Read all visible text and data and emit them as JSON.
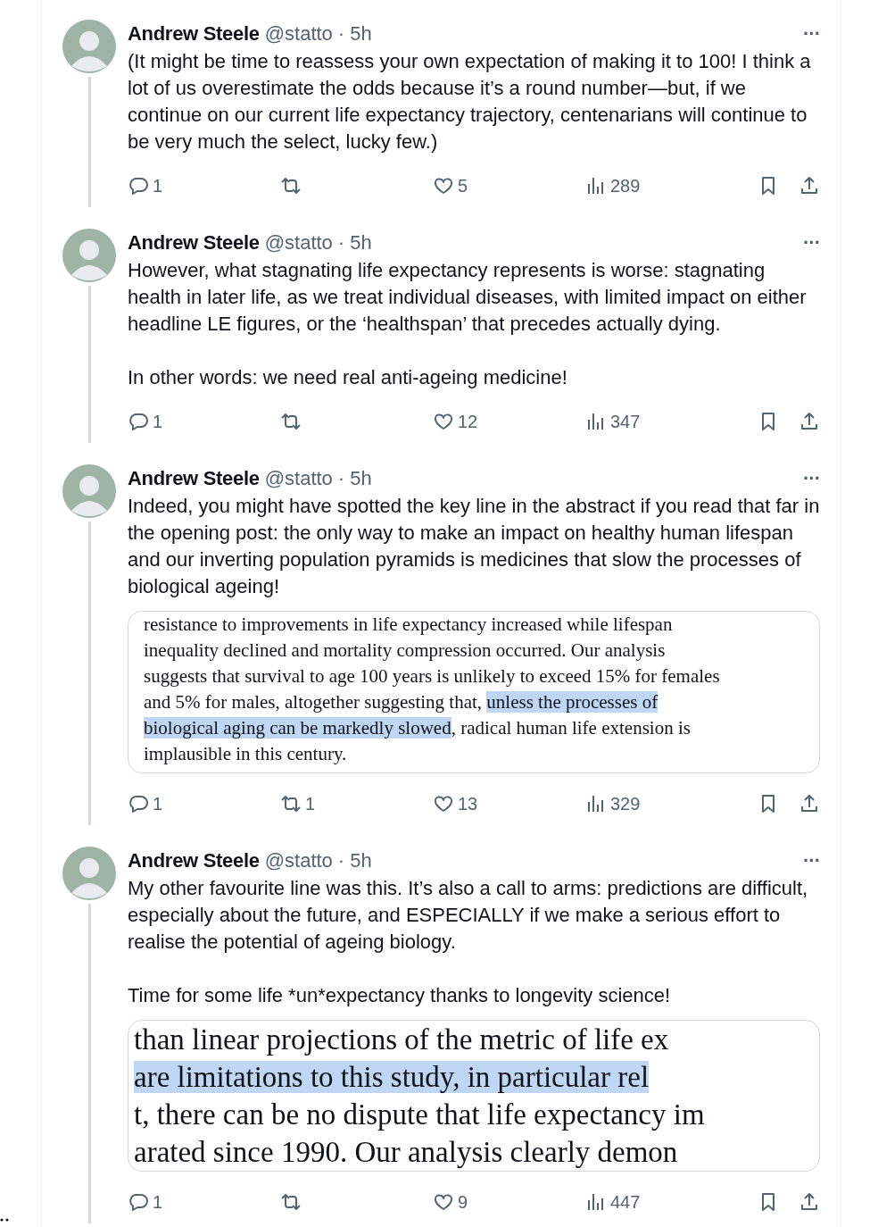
{
  "tweets": [
    {
      "name": "Andrew Steele",
      "handle": "@statto",
      "separator": "·",
      "time": "5h",
      "more": "···",
      "paragraphs": [
        "(It might be time to reassess your own expectation of making it to 100! I think a lot of us overestimate the odds because it’s a round number—but, if we continue on our current life expectancy trajectory, centenarians will continue to be very much the select, lucky few.)"
      ],
      "actions": {
        "replies": "1",
        "likes": "5",
        "views": "289"
      }
    },
    {
      "name": "Andrew Steele",
      "handle": "@statto",
      "separator": "·",
      "time": "5h",
      "more": "···",
      "paragraphs": [
        "However, what stagnating life expectancy represents is worse: stagnating health in later life, as we treat individual diseases, with limited impact on either headline LE figures, or the ‘healthspan’ that precedes actually dying.",
        "In other words: we need real anti-ageing medicine!"
      ],
      "actions": {
        "replies": "1",
        "likes": "12",
        "views": "347"
      }
    },
    {
      "name": "Andrew Steele",
      "handle": "@statto",
      "separator": "·",
      "time": "5h",
      "more": "···",
      "paragraphs": [
        "Indeed, you might have spotted the key line in the abstract if you read that far in the opening post: the only way to make an impact on healthy human lifespan and our inverting population pyramids is medicines that slow the processes of biological ageing!"
      ],
      "excerpt": {
        "kind": "small",
        "lines": [
          [
            {
              "text": "resistance to improvements in life expectancy increased while lifespan",
              "highlighted": false
            }
          ],
          [
            {
              "text": "inequality declined and mortality compression occurred. Our analysis",
              "highlighted": false
            }
          ],
          [
            {
              "text": "suggests that survival to age 100 years is unlikely to exceed 15% for females",
              "highlighted": false
            }
          ],
          [
            {
              "text": "and 5% for males, altogether suggesting that, ",
              "highlighted": false
            },
            {
              "text": "unless the processes of",
              "highlighted": true
            }
          ],
          [
            {
              "text": "biological aging can be markedly slowed",
              "highlighted": true
            },
            {
              "text": ", radical human life extension is",
              "highlighted": false
            }
          ],
          [
            {
              "text": "implausible in this century.",
              "highlighted": false
            }
          ]
        ]
      },
      "actions": {
        "replies": "1",
        "retweets": "1",
        "likes": "13",
        "views": "329"
      }
    },
    {
      "name": "Andrew Steele",
      "handle": "@statto",
      "separator": "·",
      "time": "5h",
      "more": "···",
      "paragraphs": [
        "My other favourite line was this. It’s also a call to arms: predictions are difficult, especially about the future, and ESPECIALLY if we make a serious effort to realise the potential of ageing biology.",
        "Time for some life *un*expectancy thanks to longevity science!"
      ],
      "excerpt": {
        "kind": "large",
        "lines": [
          [
            {
              "text": "than linear projections of the metric of life ex",
              "highlighted": false
            }
          ],
          [
            {
              "text": "are limitations to this study, in particular rel",
              "highlighted": true
            }
          ],
          [
            {
              "text": "t, there can be no dispute that life expectancy im",
              "highlighted": false
            }
          ],
          [
            {
              "text": "arated since 1990. Our analysis clearly demon",
              "highlighted": false
            }
          ]
        ]
      },
      "actions": {
        "replies": "1",
        "likes": "9",
        "views": "447"
      }
    }
  ]
}
